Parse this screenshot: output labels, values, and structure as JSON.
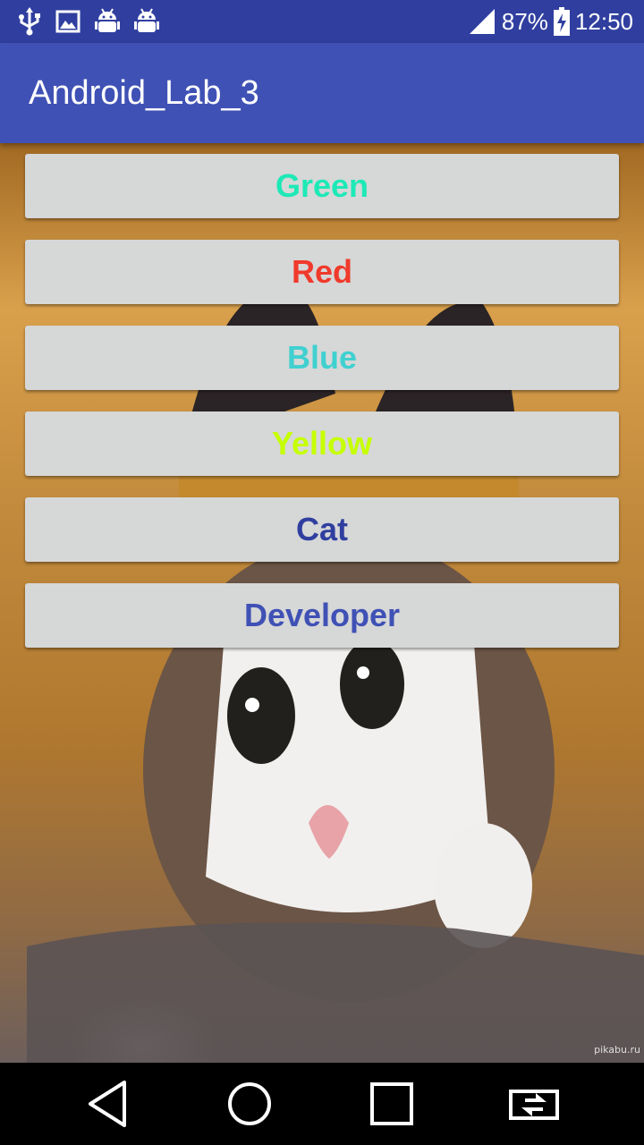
{
  "status_bar": {
    "left_icons": [
      "usb-icon",
      "image-icon",
      "android-debug-icon",
      "android-debug-icon"
    ],
    "battery_percent": "87%",
    "time": "12:50"
  },
  "app_bar": {
    "title": "Android_Lab_3",
    "background": "#3F51B5"
  },
  "buttons": [
    {
      "label": "Green",
      "color": "#1DE9B6"
    },
    {
      "label": "Red",
      "color": "#F03A2B"
    },
    {
      "label": "Blue",
      "color": "#40D0D0"
    },
    {
      "label": "Yellow",
      "color": "#C6FF00"
    },
    {
      "label": "Cat",
      "color": "#303F9F"
    },
    {
      "label": "Developer",
      "color": "#3F51B5"
    }
  ],
  "watermark": "pikabu.ru",
  "nav_bar": {
    "icons": [
      "back-icon",
      "home-icon",
      "recents-icon",
      "switch-apps-icon"
    ]
  }
}
